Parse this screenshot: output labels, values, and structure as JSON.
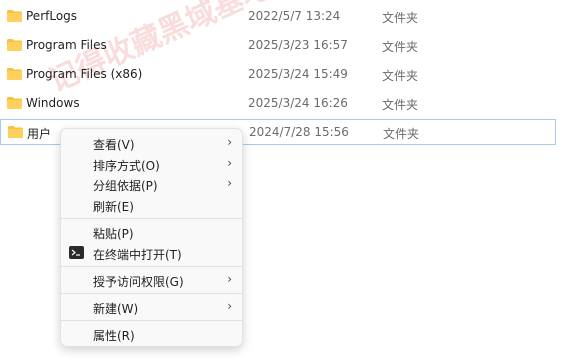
{
  "files": [
    {
      "name": "PerfLogs",
      "date": "2022/5/7 13:24",
      "type": "文件夹"
    },
    {
      "name": "Program Files",
      "date": "2025/3/23 16:57",
      "type": "文件夹"
    },
    {
      "name": "Program Files (x86)",
      "date": "2025/3/24 15:49",
      "type": "文件夹"
    },
    {
      "name": "Windows",
      "date": "2025/3/24 16:26",
      "type": "文件夹"
    },
    {
      "name": "用户",
      "date": "2024/7/28 15:56",
      "type": "文件夹"
    }
  ],
  "context_menu": {
    "items": [
      {
        "label": "查看(V)",
        "submenu": true
      },
      {
        "label": "排序方式(O)",
        "submenu": true
      },
      {
        "label": "分组依据(P)",
        "submenu": true
      },
      {
        "label": "刷新(E)",
        "submenu": false
      },
      {
        "label": "粘贴(P)",
        "submenu": false
      },
      {
        "label": "在终端中打开(T)",
        "submenu": false,
        "icon": "terminal-icon"
      },
      {
        "label": "授予访问权限(G)",
        "submenu": true
      },
      {
        "label": "新建(W)",
        "submenu": true
      },
      {
        "label": "属性(R)",
        "submenu": false
      }
    ],
    "chevron": "›"
  },
  "watermark": "记得收藏黑域基地 Hybase.com",
  "colors": {
    "folder": "#f5c242",
    "selection_border": "#aac8f0",
    "menu_bg": "#f9f9f9"
  }
}
